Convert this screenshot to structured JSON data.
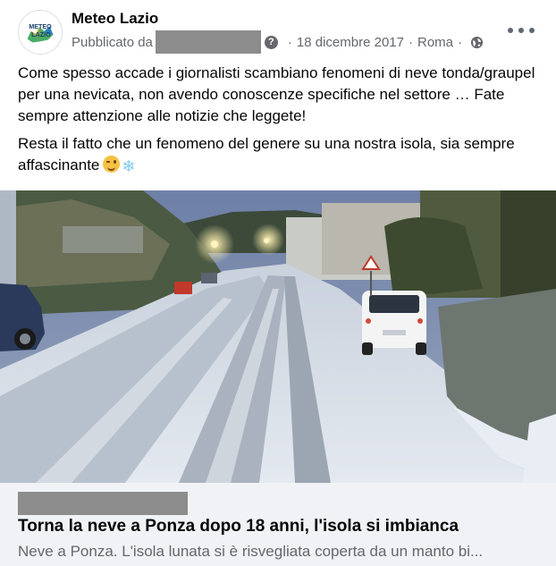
{
  "post": {
    "page_name": "Meteo Lazio",
    "avatar_text": [
      "METEO",
      "LAZIO"
    ],
    "published_by_prefix": "Pubblicato da",
    "date": "18 dicembre 2017",
    "location": "Roma",
    "separator": "·",
    "privacy_icon": "globe-icon",
    "more_icon": "more-options-icon",
    "body": [
      "Come spesso accade i giornalisti scambiano fenomeni di neve tonda/graupel per una nevicata, non avendo conoscenze specifiche nel settore … Fate sempre attenzione alle notizie che leggete!",
      "Resta il fatto che un fenomeno del genere su una nostra isola, sia sempre affascinante"
    ],
    "body_emojis": [
      "winking-face-emoji",
      "snowflake-emoji"
    ],
    "snowflake_glyph": "❄"
  },
  "link": {
    "title": "Torna la neve a Ponza dopo 18 anni, l'isola si imbianca",
    "description": "Neve a Ponza. L'isola lunata si è risvegliata coperta da un manto bi..."
  },
  "colors": {
    "text_primary": "#050505",
    "text_secondary": "#65676b",
    "preview_bg": "#f0f2f5",
    "redaction": "#8c8c8c"
  }
}
